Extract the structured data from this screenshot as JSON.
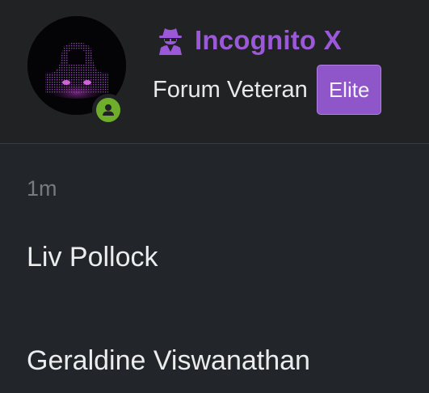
{
  "profile": {
    "username": "Incognito X",
    "user_title": "Forum Veteran",
    "banner": "Elite",
    "avatar_icon": "hooded-figure-avatar",
    "username_icon": "user-secret-icon",
    "status_icon": "online-user-icon",
    "colors": {
      "username": "#9b59d9",
      "banner_bg": "#8e56c9",
      "online": "#6fae2a"
    }
  },
  "activity": {
    "time": "1m"
  },
  "people": [
    {
      "name": "Liv Pollock"
    },
    {
      "name": "Geraldine Viswanathan"
    }
  ]
}
